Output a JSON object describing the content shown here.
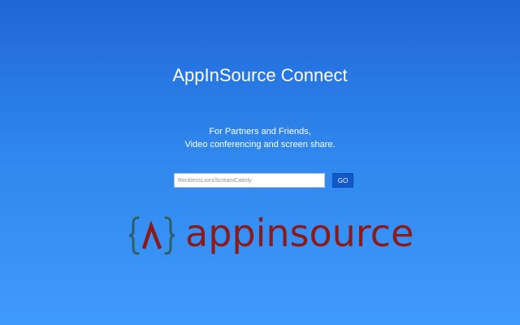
{
  "header": {
    "title": "AppInSource Connect"
  },
  "tagline": {
    "line1": "For Partners and Friends,",
    "line2": "Video conferencing and screen share."
  },
  "room_form": {
    "room_name_value": "RecklessLionsScreamCalmly",
    "go_label": "GO"
  },
  "brand": {
    "logo_text": "appinsource",
    "mark_icon": "curly-braces-lambda-icon",
    "text_color": "#8b1a1a",
    "braces_color": "#2f5f66"
  },
  "colors": {
    "background_top": "#1f66d6",
    "background_bottom": "#3f9bfb",
    "go_button": "#1258c8"
  }
}
